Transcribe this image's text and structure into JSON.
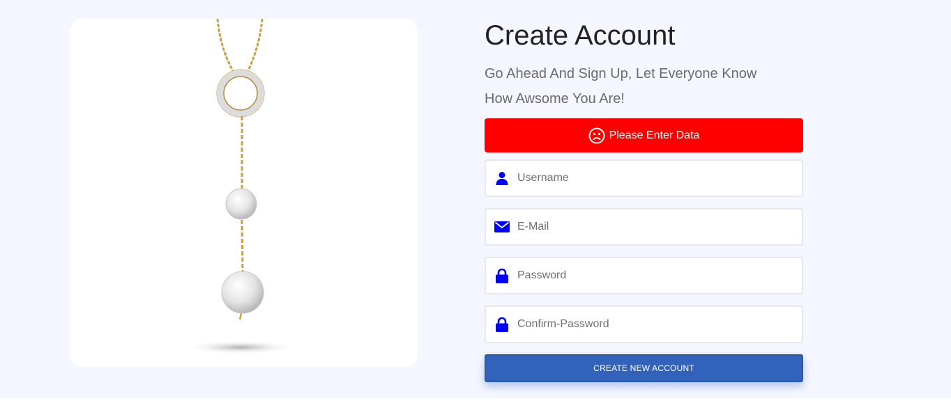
{
  "product_image": {
    "icon": "necklace-image"
  },
  "form": {
    "title": "Create Account",
    "subtitle": "Go Ahead And Sign Up, Let Everyone Know How Awsome You Are!",
    "alert": {
      "message": "Please Enter Data",
      "icon": "frown-icon",
      "color": "#ff0000"
    },
    "fields": {
      "username": {
        "placeholder": "Username",
        "value": "",
        "icon": "user-icon"
      },
      "email": {
        "placeholder": "E-Mail",
        "value": "",
        "icon": "envelope-icon"
      },
      "password": {
        "placeholder": "Password",
        "value": "",
        "icon": "lock-icon"
      },
      "confirm_password": {
        "placeholder": "Confirm-Password",
        "value": "",
        "icon": "lock-icon"
      }
    },
    "submit_label": "CREATE NEW ACCOUNT",
    "accent_color": "#3263ba",
    "icon_color": "#0000ff"
  }
}
